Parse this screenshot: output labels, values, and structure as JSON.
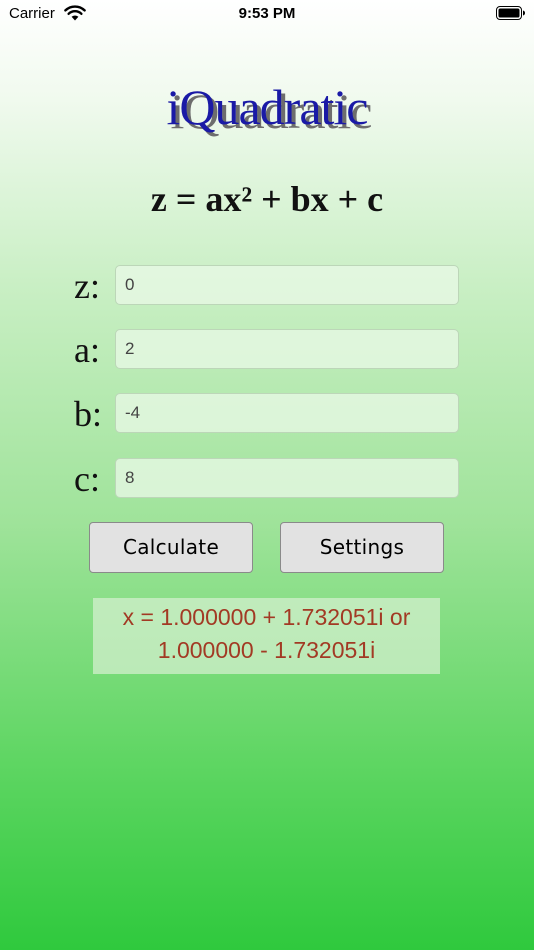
{
  "status_bar": {
    "carrier": "Carrier",
    "time": "9:53 PM",
    "wifi_icon": "wifi-icon",
    "battery_icon": "battery-icon"
  },
  "app": {
    "title": "iQuadratic",
    "equation": "z = ax² + bx + c"
  },
  "form": {
    "fields": [
      {
        "label": "z:",
        "value": "0"
      },
      {
        "label": "a:",
        "value": "2"
      },
      {
        "label": "b:",
        "value": "-4"
      },
      {
        "label": "c:",
        "value": "8"
      }
    ]
  },
  "buttons": {
    "calculate": "Calculate",
    "settings": "Settings"
  },
  "result": {
    "line1": "x = 1.000000 + 1.732051i or",
    "line2": "1.000000 - 1.732051i"
  },
  "colors": {
    "title": "#1a1aa6",
    "result_text": "#a23a24",
    "gradient_bottom": "#2fc93d"
  }
}
